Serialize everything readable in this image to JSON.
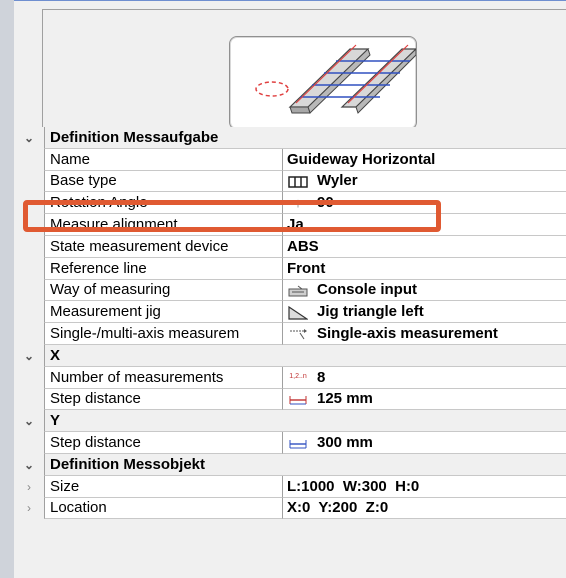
{
  "panel": {
    "categories": {
      "definition_task": "Definition Messaufgabe",
      "x": "X",
      "y": "Y",
      "definition_object": "Definition Messobjekt"
    },
    "rows": {
      "name": {
        "label": "Name",
        "value": "Guideway Horizontal"
      },
      "base_type": {
        "label": "Base type",
        "value": "Wyler",
        "icon": "base-type-icon"
      },
      "rotation_angle": {
        "label": "Rotation Angle",
        "value": "90",
        "icon": "arrow-up-icon",
        "icon_char": "↑"
      },
      "measure_alignment": {
        "label": "Measure alignment",
        "value": "Ja"
      },
      "state_device": {
        "label": "State measurement device",
        "value": "ABS"
      },
      "reference_line": {
        "label": "Reference line",
        "value": "Front"
      },
      "way_of_measuring": {
        "label": "Way of measuring",
        "value": "Console input",
        "icon": "console-icon"
      },
      "measurement_jig": {
        "label": "Measurement jig",
        "value": "Jig triangle left",
        "icon": "jig-triangle-icon"
      },
      "axis_mode": {
        "label": "Single-/multi-axis measurem",
        "value": "Single-axis measurement",
        "icon": "single-axis-icon"
      },
      "num_measurements": {
        "label": "Number of measurements",
        "value": "8",
        "icon": "counter-icon",
        "icon_text": "1,2..n"
      },
      "step_distance_x": {
        "label": "Step distance",
        "value": "125 mm",
        "icon": "step-distance-icon"
      },
      "step_distance_y": {
        "label": "Step distance",
        "value": "300 mm",
        "icon": "step-distance-icon"
      },
      "size": {
        "label": "Size",
        "value": "L:1000  W:300  H:0"
      },
      "location": {
        "label": "Location",
        "value": "X:0  Y:200  Z:0"
      }
    },
    "expand_glyph": "⌄",
    "collapsed_glyph": "›",
    "highlight_color": "#e05a32"
  }
}
